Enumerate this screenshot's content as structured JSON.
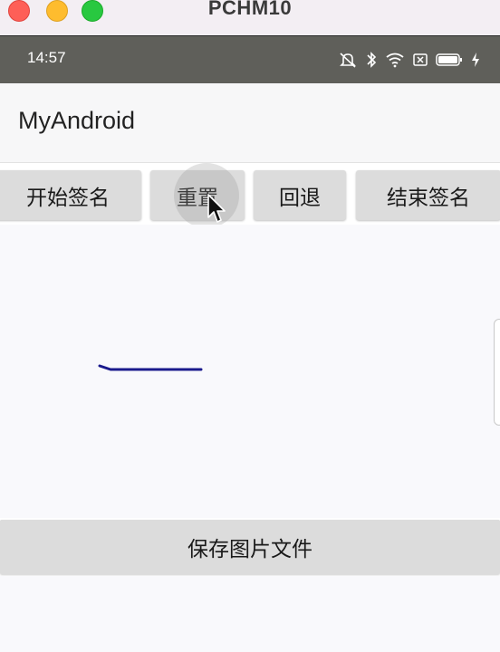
{
  "window": {
    "title": "PCHM10"
  },
  "status_bar": {
    "time": "14:57",
    "icons": [
      "mute-icon",
      "bluetooth-icon",
      "wifi-icon",
      "sim-icon",
      "battery-icon",
      "charging-icon"
    ]
  },
  "app_bar": {
    "title": "MyAndroid"
  },
  "toolbar": {
    "start_label": "开始签名",
    "reset_label": "重置",
    "undo_label": "回退",
    "end_label": "结束签名"
  },
  "save": {
    "label": "保存图片文件"
  },
  "colors": {
    "stroke": "#1a1a8c",
    "button_bg": "#dcdcdc",
    "status_bar_bg": "#5f5f5a"
  }
}
